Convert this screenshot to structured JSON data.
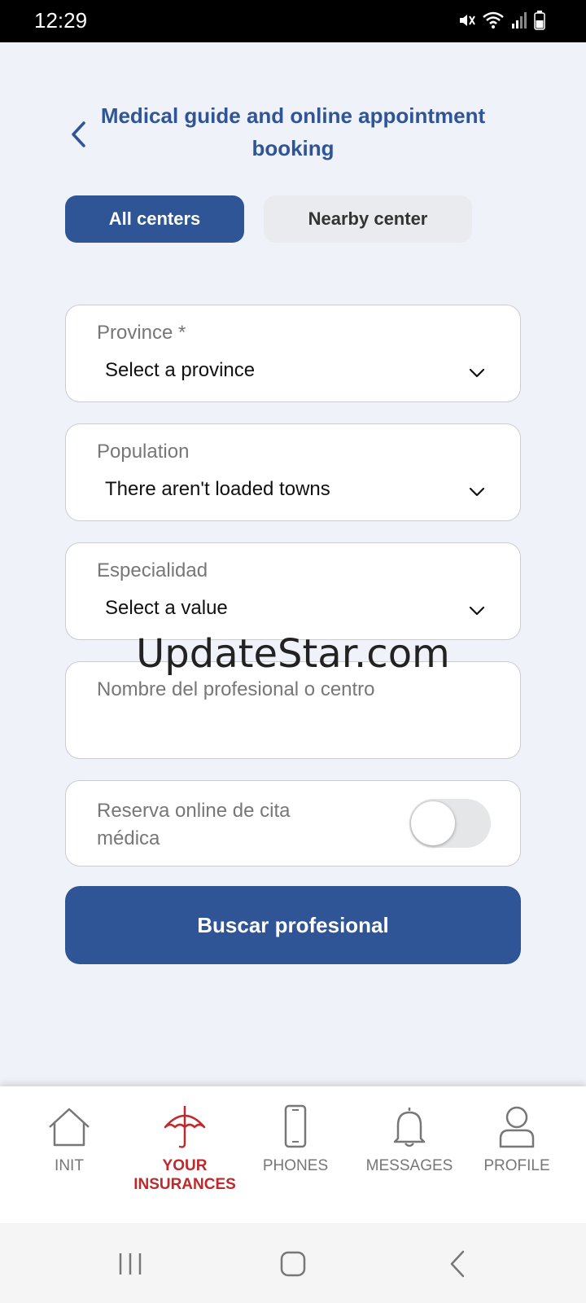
{
  "status_bar": {
    "time": "12:29"
  },
  "header": {
    "title": "Medical guide and online appointment booking"
  },
  "tabs": [
    {
      "label": "All centers",
      "active": true
    },
    {
      "label": "Nearby center",
      "active": false
    }
  ],
  "form": {
    "province": {
      "label": "Province *",
      "value": "Select a province"
    },
    "population": {
      "label": "Population",
      "value": "There aren't loaded towns"
    },
    "specialty": {
      "label": "Especialidad",
      "value": "Select a value"
    },
    "name_search": {
      "placeholder": "Nombre del profesional o centro"
    },
    "online_booking": {
      "label": "Reserva online de cita médica",
      "enabled": false
    },
    "submit_label": "Buscar profesional"
  },
  "watermark": "UpdateStar.com",
  "bottom_nav": [
    {
      "label": "INIT",
      "icon": "home-icon",
      "active": false
    },
    {
      "label": "YOUR INSURANCES",
      "icon": "umbrella-icon",
      "active": true
    },
    {
      "label": "PHONES",
      "icon": "phone-icon",
      "active": false
    },
    {
      "label": "MESSAGES",
      "icon": "bell-icon",
      "active": false
    },
    {
      "label": "PROFILE",
      "icon": "user-icon",
      "active": false
    }
  ],
  "colors": {
    "primary": "#2f5597",
    "active_nav": "#c0292b",
    "background": "#eff3f9"
  }
}
